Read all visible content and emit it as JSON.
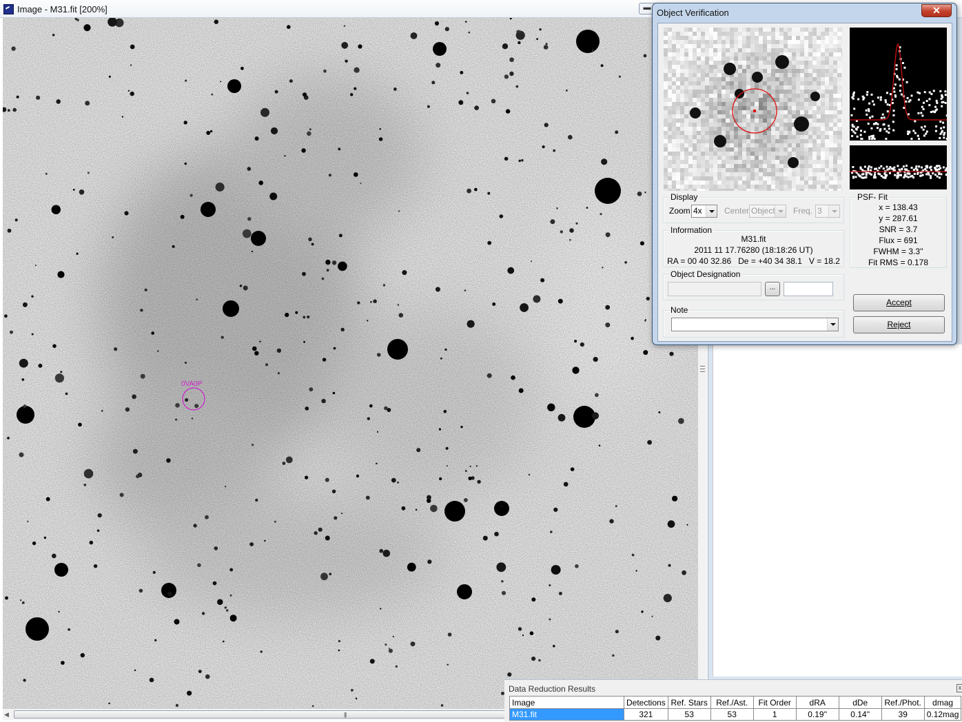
{
  "image_window": {
    "title": "Image - M31.fit [200%]",
    "object_marker": "0VA0P"
  },
  "dialog": {
    "title": "Object Verification",
    "close_glyph": "✕",
    "display": {
      "caption": "Display",
      "zoom_label": "Zoom",
      "zoom_value": "4x",
      "center_label": "Center",
      "center_value": "Object",
      "freq_label": "Freq.",
      "freq_value": "3"
    },
    "psf_fit": {
      "caption": "PSF- Fit",
      "x": "x = 138.43",
      "y": "y = 287.61",
      "snr": "SNR = 3.7",
      "flux": "Flux = 691",
      "fwhm": "FWHM = 3.3''",
      "fit_rms": "Fit RMS = 0.178"
    },
    "information": {
      "caption": "Information",
      "file": "M31.fit",
      "date": "2011 11 17.76280 (18:18:26 UT)",
      "coords": "RA = 00 40 32.86   De = +40 34 38.1   V = 18.2"
    },
    "designation": {
      "caption": "Object Designation",
      "browse_glyph": "...",
      "value": "",
      "extra": ""
    },
    "note": {
      "caption": "Note",
      "value": ""
    },
    "accept_label": "Accept",
    "reject_label": "Reject"
  },
  "results": {
    "title": "Data Reduction Results",
    "close_glyph": "x",
    "columns": [
      "Image",
      "Detections",
      "Ref. Stars",
      "Ref./Ast.",
      "Fit Order",
      "dRA",
      "dDe",
      "Ref./Phot.",
      "dmag"
    ],
    "rows": [
      [
        "M31.fit",
        "321",
        "53",
        "53",
        "1",
        "0.19''",
        "0.14''",
        "39",
        "0.12mag"
      ]
    ]
  },
  "icons": {
    "app": "telescope-app-icon",
    "minimize": "minimize-icon",
    "close": "close-icon",
    "dropdown": "chevron-down-icon"
  },
  "colors": {
    "aperture_circle": "#e01010",
    "psf_curve": "#cc1010",
    "object_marker": "#cc22cc",
    "selection": "#3399ff"
  }
}
